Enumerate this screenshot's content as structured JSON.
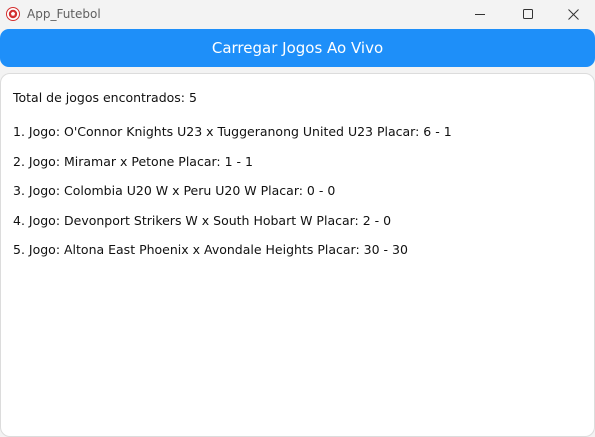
{
  "window": {
    "title": "App_Futebol"
  },
  "toolbar": {
    "load_label": "Carregar Jogos Ao Vivo"
  },
  "results": {
    "total_text": "Total de jogos encontrados: 5",
    "games": [
      "1. Jogo: O'Connor Knights U23 x Tuggeranong United U23 Placar: 6 - 1",
      "2. Jogo: Miramar x Petone Placar: 1 - 1",
      "3. Jogo: Colombia U20 W x Peru U20 W Placar: 0 - 0",
      "4. Jogo: Devonport Strikers W x South Hobart W Placar: 2 - 0",
      "5. Jogo: Altona East Phoenix x Avondale Heights Placar: 30 - 30"
    ]
  },
  "colors": {
    "accent": "#1e8ff9",
    "app_icon": "#d32f2f"
  },
  "icons": {
    "app": "soccer-ball-icon",
    "minimize": "minimize-icon",
    "maximize": "maximize-icon",
    "close": "close-icon"
  }
}
